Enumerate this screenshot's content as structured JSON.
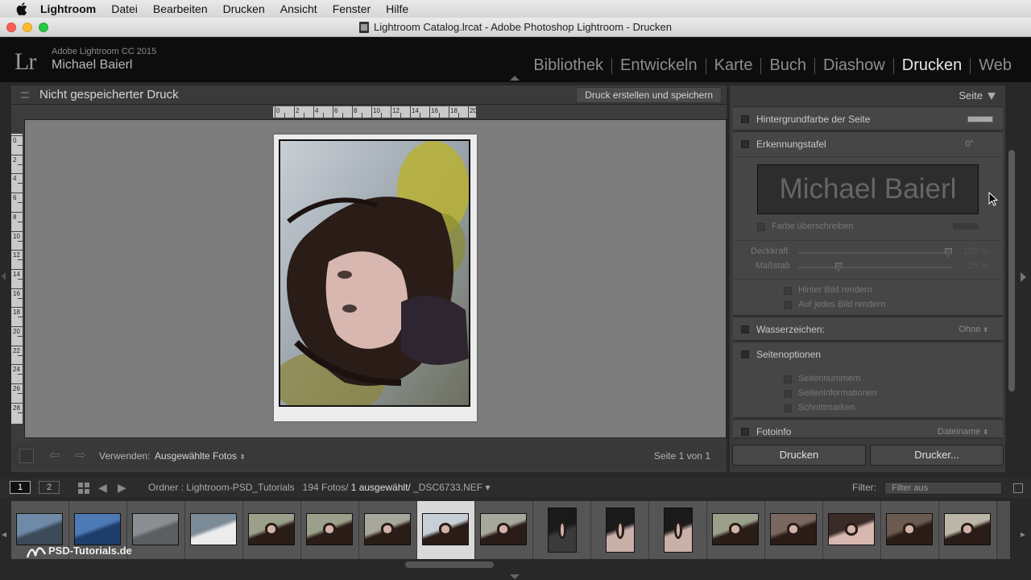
{
  "menubar": {
    "apple_icon": "apple-icon",
    "app": "Lightroom",
    "items": [
      "Datei",
      "Bearbeiten",
      "Drucken",
      "Ansicht",
      "Fenster",
      "Hilfe"
    ]
  },
  "window": {
    "title": "Lightroom Catalog.lrcat - Adobe Photoshop Lightroom - Drucken"
  },
  "identity": {
    "logo": "Lr",
    "product": "Adobe Lightroom CC 2015",
    "user": "Michael Baierl"
  },
  "modules": [
    "Bibliothek",
    "Entwickeln",
    "Karte",
    "Buch",
    "Diashow",
    "Drucken",
    "Web"
  ],
  "active_module": "Drucken",
  "center": {
    "title": "Nicht gespeicherter Druck",
    "save_button": "Druck erstellen und speichern",
    "ruler_top": [
      "0",
      "2",
      "4",
      "6",
      "8",
      "10",
      "12",
      "14",
      "16",
      "18",
      "20"
    ],
    "ruler_left": [
      "0",
      "2",
      "4",
      "6",
      "8",
      "10",
      "12",
      "14",
      "16",
      "18",
      "20",
      "22",
      "24",
      "26",
      "28"
    ]
  },
  "bottombar": {
    "use_label": "Verwenden:",
    "use_value": "Ausgewählte Fotos",
    "page": "Seite 1 von 1"
  },
  "panel": {
    "header": "Seite",
    "background_color_label": "Hintergrundfarbe der Seite",
    "identity_plate_label": "Erkennungstafel",
    "identity_plate_angle": "0°",
    "identity_plate_text": "Michael Baierl",
    "override_color": "Farbe überschreiben",
    "opacity_label": "Deckkraft",
    "opacity_value": "100 %",
    "opacity": 1.0,
    "scale_label": "Maßstab",
    "scale_value": "25 %",
    "scale": 0.25,
    "render_behind": "Hinter Bild rendern",
    "render_every": "Auf jedes Bild rendern",
    "watermark_label": "Wasserzeichen:",
    "watermark_value": "Ohne",
    "page_options_label": "Seitenoptionen",
    "page_numbers": "Seitennummern",
    "page_info": "Seiteninformationen",
    "crop_marks": "Schnittmarken",
    "photo_info_label": "Fotoinfo",
    "photo_info_value": "Dateiname",
    "print_button": "Drucken",
    "printer_button": "Drucker..."
  },
  "filmstrip": {
    "page1": "1",
    "page2": "2",
    "path": "Ordner : Lightroom-PSD_Tutorials",
    "count": "194 Fotos/",
    "selected": "1 ausgewählt/",
    "filename": "_DSC6733.NEF",
    "filter_label": "Filter:",
    "filter_value": "Filter aus",
    "watermark": "PSD-Tutorials.de"
  },
  "colors": {
    "accent": "#e8e8e8",
    "panel": "#464646",
    "canvas": "#7d7d7d"
  }
}
